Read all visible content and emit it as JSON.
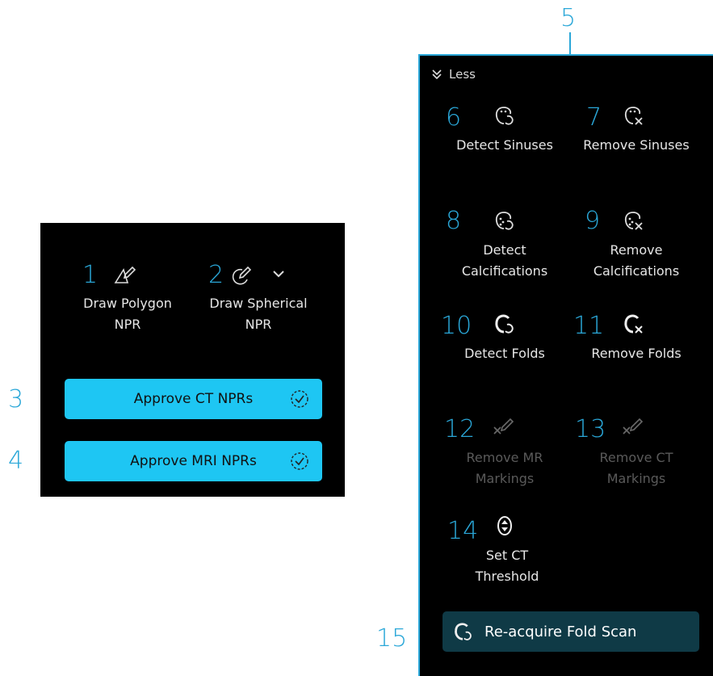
{
  "callouts": {
    "n1": "1",
    "n2": "2",
    "n3": "3",
    "n4": "4",
    "n5": "5",
    "n6": "6",
    "n7": "7",
    "n8": "8",
    "n9": "9",
    "n10": "10",
    "n11": "11",
    "n12": "12",
    "n13": "13",
    "n14": "14",
    "n15": "15"
  },
  "npr_panel": {
    "draw_polygon": {
      "line1": "Draw Polygon",
      "line2": "NPR",
      "icon": "polygon-pencil-icon"
    },
    "draw_spherical": {
      "line1": "Draw Spherical",
      "line2": "NPR",
      "icon": "sphere-pencil-icon",
      "dropdown_icon": "chevron-down-icon"
    },
    "approve_ct": {
      "label": "Approve CT NPRs",
      "icon": "check-circle-icon"
    },
    "approve_mri": {
      "label": "Approve MRI NPRs",
      "icon": "check-circle-icon"
    },
    "accent": "#1ec6f3"
  },
  "tools_panel": {
    "toggle": {
      "label": "Less",
      "icon": "double-chevron-down-icon"
    },
    "detect_sinuses": {
      "label": "Detect Sinuses",
      "icon": "sinus-detect-icon"
    },
    "remove_sinuses": {
      "label": "Remove Sinuses",
      "icon": "sinus-remove-icon"
    },
    "detect_calc": {
      "line1": "Detect",
      "line2": "Calcifications",
      "icon": "calcification-detect-icon"
    },
    "remove_calc": {
      "line1": "Remove",
      "line2": "Calcifications",
      "icon": "calcification-remove-icon"
    },
    "detect_folds": {
      "label": "Detect Folds",
      "icon": "fold-detect-icon"
    },
    "remove_folds": {
      "label": "Remove Folds",
      "icon": "fold-remove-icon"
    },
    "remove_mr": {
      "line1": "Remove MR",
      "line2": "Markings",
      "icon": "erase-pencil-icon",
      "disabled": true
    },
    "remove_ct": {
      "line1": "Remove CT",
      "line2": "Markings",
      "icon": "erase-pencil-icon",
      "disabled": true
    },
    "set_ct": {
      "line1": "Set CT",
      "line2": "Threshold",
      "icon": "threshold-icon"
    },
    "reacquire": {
      "label": "Re-acquire Fold Scan",
      "icon": "reacquire-icon"
    },
    "accent": "#2aa7d8",
    "button_bg": "#0f3a46"
  }
}
